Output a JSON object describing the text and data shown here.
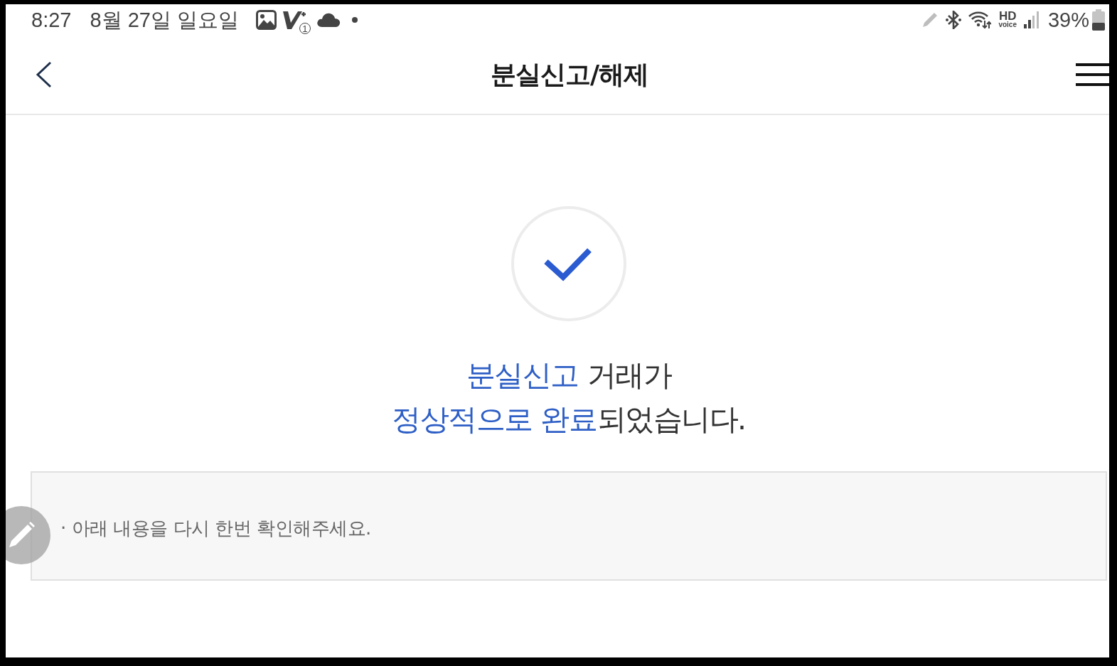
{
  "status_bar": {
    "time": "8:27",
    "date": "8월 27일 일요일",
    "notification_badge": "1",
    "hd_voice": [
      "HD",
      "voice"
    ],
    "battery_text": "39%"
  },
  "header": {
    "title": "분실신고/해제"
  },
  "result": {
    "lines": [
      [
        {
          "text": "분실신고",
          "highlight": true
        },
        {
          "text": " 거래가",
          "highlight": false
        }
      ],
      [
        {
          "text": "정상적으로 완료",
          "highlight": true
        },
        {
          "text": "되었습니다.",
          "highlight": false
        }
      ]
    ]
  },
  "notice": {
    "items": [
      "· 아래 내용을 다시 한번 확인해주세요."
    ]
  }
}
